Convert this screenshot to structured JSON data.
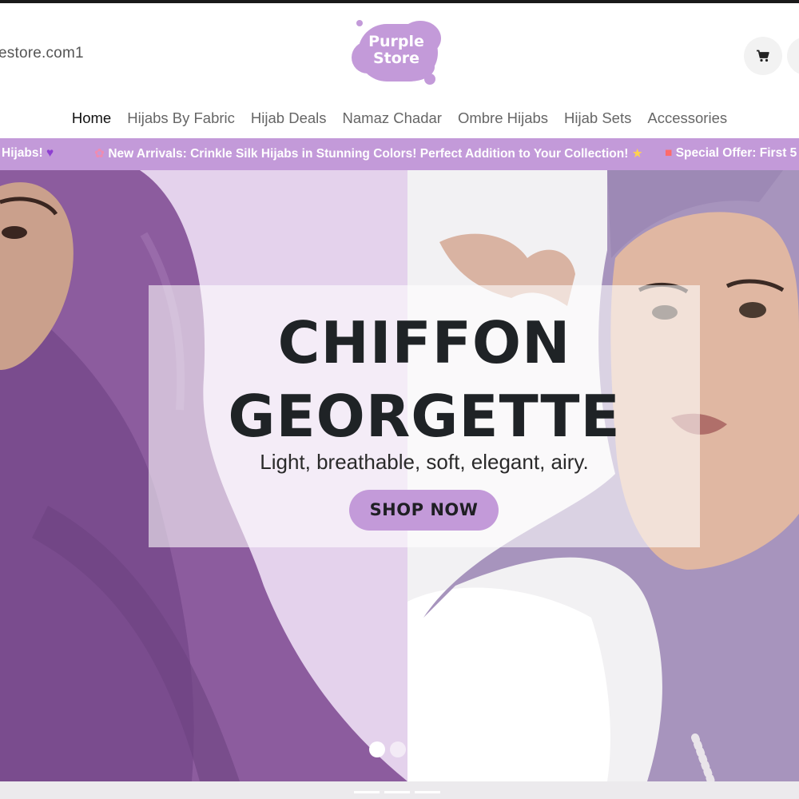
{
  "header": {
    "contact_email": "estore.com1",
    "logo_text_line1": "Purple",
    "logo_text_line2": "Store",
    "cart_icon": "cart-icon",
    "user_icon": "user-icon"
  },
  "nav": {
    "items": [
      {
        "label": "Home",
        "active": true
      },
      {
        "label": "Hijabs By Fabric"
      },
      {
        "label": "Hijab Deals"
      },
      {
        "label": "Namaz Chadar"
      },
      {
        "label": "Ombre Hijabs"
      },
      {
        "label": "Hijab Sets"
      },
      {
        "label": "Accessories"
      }
    ]
  },
  "announcement": {
    "items": [
      "Hijabs!",
      "New Arrivals: Crinkle Silk Hijabs in Stunning Colors! Perfect Addition to Your Collection!",
      "Special Offer: First 5"
    ]
  },
  "hero": {
    "title_line1": "CHIFFON",
    "title_line2": "GEORGETTE",
    "subtitle": "Light, breathable, soft, elegant, airy.",
    "cta_label": "SHOP NOW",
    "slides": [
      {
        "active": true
      },
      {
        "active": false
      },
      {
        "active": false
      }
    ]
  },
  "colors": {
    "brand_purple": "#c39ad9",
    "hijab_dark": "#8a5a9c",
    "hijab_light": "#a693b8"
  }
}
